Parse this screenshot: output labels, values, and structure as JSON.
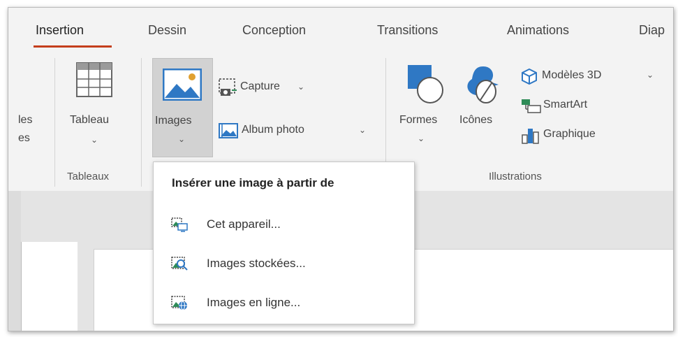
{
  "tabs": [
    {
      "label": "Insertion"
    },
    {
      "label": "Dessin"
    },
    {
      "label": "Conception"
    },
    {
      "label": "Transitions"
    },
    {
      "label": "Animations"
    },
    {
      "label": "Diap"
    }
  ],
  "ribbon": {
    "cut_left_top": "les",
    "cut_left_bottom": "es",
    "tableau_label": "Tableau",
    "tableaux_group": "Tableaux",
    "images_label": "Images",
    "capture_label": "Capture",
    "album_label": "Album photo",
    "formes_label": "Formes",
    "icones_label": "Icônes",
    "modeles3d_label": "Modèles 3D",
    "smartart_label": "SmartArt",
    "graphique_label": "Graphique",
    "illustrations_group": "Illustrations"
  },
  "menu": {
    "title": "Insérer une image à partir de",
    "items": [
      {
        "label": "Cet appareil..."
      },
      {
        "label": "Images stockées..."
      },
      {
        "label": "Images en ligne..."
      }
    ]
  },
  "colors": {
    "accent": "#c43e1c",
    "icon_blue": "#2f78c4",
    "icon_green": "#2e8b57"
  }
}
